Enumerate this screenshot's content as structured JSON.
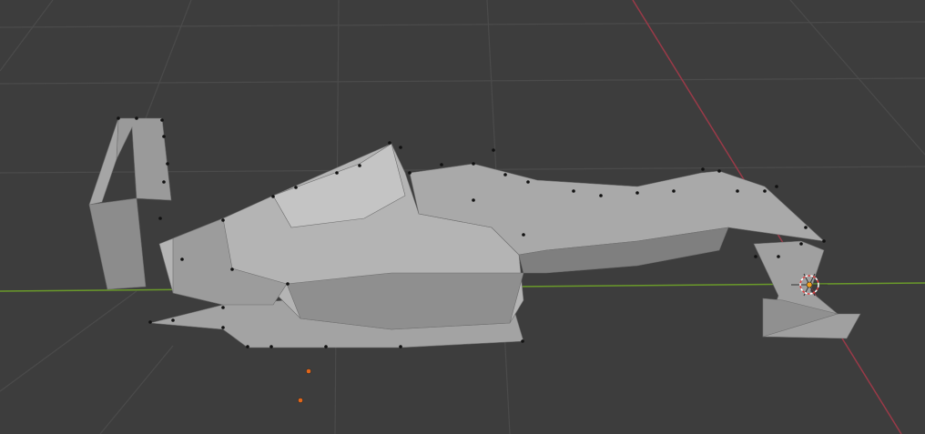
{
  "viewport": {
    "background": "#3d3d3d",
    "grid_color": "#4b4b4b",
    "x_axis_color": "#6a9a2a",
    "y_axis_color": "#9a3a48",
    "mesh_color": "#a8a8a8",
    "vertex_color": "#111111",
    "origin_color": "#f08020",
    "icons": [
      "3d-cursor-icon",
      "object-origin-icon"
    ]
  }
}
